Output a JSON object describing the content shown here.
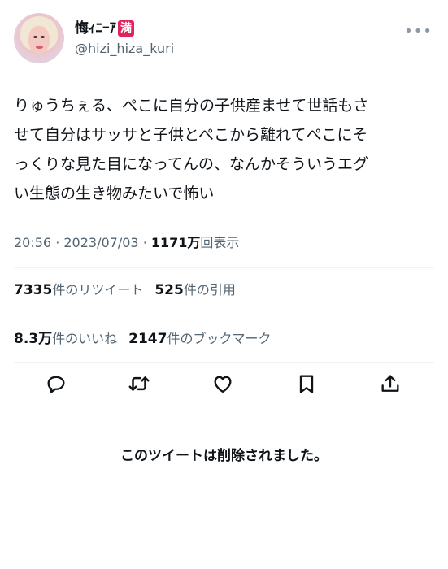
{
  "user": {
    "display_name": "悔ｨﾆｰｱ",
    "badge": "満",
    "handle": "@hizi_hiza_kuri"
  },
  "tweet": {
    "text": "りゅうちぇる、ぺこに自分の子供産ませて世話もさ\nせて自分はサッサと子供とぺこから離れてぺこにそ\nっくりな見た目になってんの、なんかそういうエグ\nい生態の生き物みたいで怖い"
  },
  "meta": {
    "time": "20:56",
    "date": "2023/07/03",
    "views": "1171万",
    "views_label": "回表示"
  },
  "stats": {
    "retweets": "7335",
    "retweets_label": "件のリツイート",
    "quotes": "525",
    "quotes_label": "件の引用",
    "likes": "8.3万",
    "likes_label": "件のいいね",
    "bookmarks": "2147",
    "bookmarks_label": "件のブックマーク"
  },
  "icons": {
    "reply": "reply-icon",
    "retweet": "retweet-icon",
    "like": "heart-icon",
    "bookmark": "bookmark-icon",
    "share": "share-icon",
    "more": "more-icon"
  },
  "deleted_notice": "このツイートは削除されました。"
}
